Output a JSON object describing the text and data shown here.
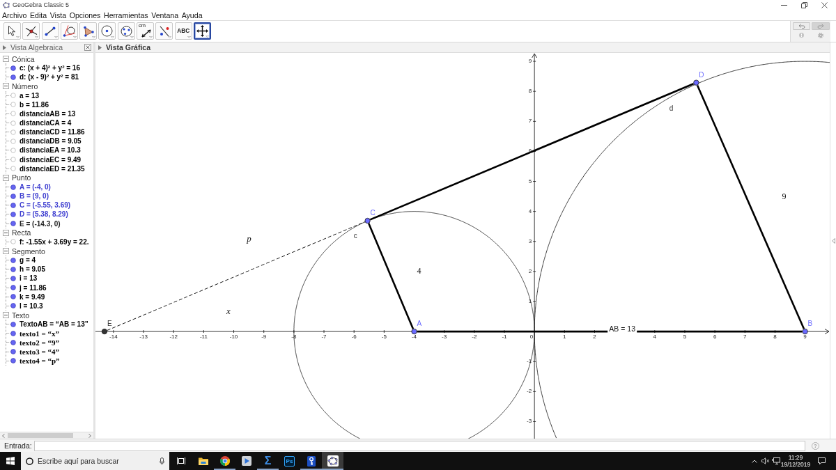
{
  "window": {
    "title": "GeoGebra Classic 5"
  },
  "menu": [
    "Archivo",
    "Edita",
    "Vista",
    "Opciones",
    "Herramientas",
    "Ventana",
    "Ayuda"
  ],
  "toolbar": {
    "tools": [
      {
        "kind": "move",
        "selected": false
      },
      {
        "kind": "intersect",
        "selected": false
      },
      {
        "kind": "segment",
        "selected": false
      },
      {
        "kind": "tangents",
        "selected": false
      },
      {
        "kind": "polygon",
        "selected": false
      },
      {
        "kind": "circle",
        "selected": false
      },
      {
        "kind": "conic",
        "selected": false
      },
      {
        "kind": "distance",
        "label": "cm",
        "selected": false
      },
      {
        "kind": "reflect",
        "selected": false
      },
      {
        "kind": "text",
        "label": "ABC",
        "selected": false
      },
      {
        "kind": "move-view",
        "selected": true
      }
    ]
  },
  "algebra_view": {
    "title": "Vista Algebraica",
    "groups": [
      {
        "name": "Cónica",
        "expanded": true,
        "children": [
          {
            "text": "c: (x + 4)² + y² = 16",
            "visible": true,
            "color": "#000000",
            "kind": "plain"
          },
          {
            "text": "d: (x - 9)² + y² = 81",
            "visible": true,
            "color": "#000000",
            "kind": "plain"
          }
        ]
      },
      {
        "name": "Número",
        "expanded": true,
        "children": [
          {
            "text": "a = 13",
            "visible": false,
            "color": "#000000",
            "kind": "plain"
          },
          {
            "text": "b = 11.86",
            "visible": false,
            "color": "#000000",
            "kind": "plain"
          },
          {
            "text": "distanciaAB = 13",
            "visible": false,
            "color": "#000000",
            "kind": "plain"
          },
          {
            "text": "distanciaCA = 4",
            "visible": false,
            "color": "#000000",
            "kind": "plain"
          },
          {
            "text": "distanciaCD = 11.86",
            "visible": false,
            "color": "#000000",
            "kind": "plain"
          },
          {
            "text": "distanciaDB = 9.05",
            "visible": false,
            "color": "#000000",
            "kind": "plain"
          },
          {
            "text": "distanciaEA = 10.3",
            "visible": false,
            "color": "#000000",
            "kind": "plain"
          },
          {
            "text": "distanciaEC = 9.49",
            "visible": false,
            "color": "#000000",
            "kind": "plain"
          },
          {
            "text": "distanciaED = 21.35",
            "visible": false,
            "color": "#000000",
            "kind": "plain"
          }
        ]
      },
      {
        "name": "Punto",
        "expanded": true,
        "children": [
          {
            "text": "A = (-4, 0)",
            "visible": true,
            "color": "#3c3cd0",
            "kind": "plain"
          },
          {
            "text": "B = (9, 0)",
            "visible": true,
            "color": "#3c3cd0",
            "kind": "plain"
          },
          {
            "text": "C = (-5.55, 3.69)",
            "visible": true,
            "color": "#3c3cd0",
            "kind": "plain"
          },
          {
            "text": "D = (5.38, 8.29)",
            "visible": true,
            "color": "#3c3cd0",
            "kind": "plain"
          },
          {
            "text": "E = (-14.3, 0)",
            "visible": true,
            "color": "#222222",
            "kind": "plain"
          }
        ]
      },
      {
        "name": "Recta",
        "expanded": true,
        "children": [
          {
            "text": "f: -1.55x + 3.69y = 22.",
            "visible": false,
            "color": "#000000",
            "kind": "plain"
          }
        ]
      },
      {
        "name": "Segmento",
        "expanded": true,
        "children": [
          {
            "text": "g = 4",
            "visible": true,
            "color": "#000000",
            "kind": "plain"
          },
          {
            "text": "h = 9.05",
            "visible": true,
            "color": "#000000",
            "kind": "plain"
          },
          {
            "text": "i = 13",
            "visible": true,
            "color": "#000000",
            "kind": "plain"
          },
          {
            "text": "j = 11.86",
            "visible": true,
            "color": "#000000",
            "kind": "plain"
          },
          {
            "text": "k = 9.49",
            "visible": true,
            "color": "#000000",
            "kind": "plain"
          },
          {
            "text": "l = 10.3",
            "visible": true,
            "color": "#000000",
            "kind": "plain"
          }
        ]
      },
      {
        "name": "Texto",
        "expanded": true,
        "children": [
          {
            "text": "TextoAB = “AB = 13”",
            "visible": true,
            "color": "#000000",
            "kind": "plain"
          },
          {
            "text": "texto1 = “x”",
            "visible": true,
            "color": "#000000",
            "kind": "latex"
          },
          {
            "text": "texto2 = “9”",
            "visible": true,
            "color": "#000000",
            "kind": "latex"
          },
          {
            "text": "texto3 = “4”",
            "visible": true,
            "color": "#000000",
            "kind": "latex"
          },
          {
            "text": "texto4 = “p”",
            "visible": true,
            "color": "#000000",
            "kind": "latex"
          }
        ]
      }
    ]
  },
  "graphics_view": {
    "title": "Vista Gráfica",
    "xtick_labels": [
      "-14",
      "-13",
      "-12",
      "-11",
      "-10",
      "-9",
      "-8",
      "-7",
      "-6",
      "-5",
      "-4",
      "-3",
      "-2",
      "-1",
      "0",
      "1",
      "2",
      "4",
      "5",
      "6",
      "7",
      "8",
      "9"
    ],
    "ytick_labels": [
      "9",
      "8",
      "7",
      "6",
      "5",
      "4",
      "3",
      "2",
      "1",
      "-1",
      "-2",
      "-3"
    ],
    "circles": [
      {
        "label": "c"
      },
      {
        "label": "d"
      }
    ],
    "segments": [
      {
        "kind": "thick"
      },
      {
        "kind": "thick"
      },
      {
        "kind": "thick"
      },
      {
        "kind": "thick"
      },
      {
        "kind": "dashed"
      }
    ],
    "points": [
      {
        "label": "A",
        "color": "#6a6aff"
      },
      {
        "label": "B",
        "color": "#6a6aff"
      },
      {
        "label": "C",
        "color": "#6a6aff"
      },
      {
        "label": "D",
        "color": "#6a6aff"
      },
      {
        "label": "E",
        "color": "#333333"
      }
    ],
    "texts": [
      {
        "text": "AB = 13",
        "kind": "caption"
      },
      {
        "text": "x",
        "kind": "variable"
      },
      {
        "text": "9",
        "kind": "number"
      },
      {
        "text": "4",
        "kind": "number"
      },
      {
        "text": "p",
        "kind": "variable"
      }
    ]
  },
  "input_bar": {
    "label": "Entrada:",
    "help": "?"
  },
  "taskbar": {
    "search": {
      "placeholder": "Escribe aquí para buscar"
    },
    "apps": [
      {
        "kind": "explorer",
        "running": false,
        "selected": false
      },
      {
        "kind": "chrome",
        "running": true,
        "selected": false
      },
      {
        "kind": "media",
        "running": false,
        "selected": false
      },
      {
        "kind": "sigma",
        "label": "Σ",
        "running": true,
        "selected": false
      },
      {
        "kind": "photoshop",
        "label": "Ps",
        "running": false,
        "selected": false
      },
      {
        "kind": "key",
        "running": true,
        "selected": false
      },
      {
        "kind": "geogebra",
        "running": true,
        "selected": true
      }
    ],
    "clock": {
      "time": "11:29",
      "date": "19/12/2019"
    }
  }
}
